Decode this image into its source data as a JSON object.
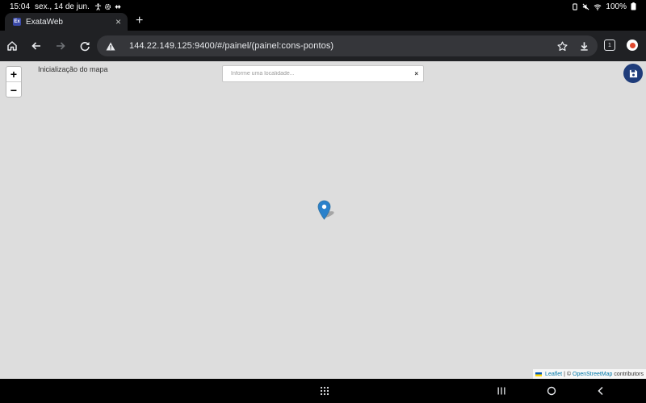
{
  "status_bar": {
    "time": "15:04",
    "date": "sex., 14 de jun.",
    "battery": "100%"
  },
  "tab": {
    "favicon_text": "Ex",
    "title": "ExataWeb",
    "close_symbol": "×",
    "new_tab_symbol": "+"
  },
  "toolbar": {
    "url": "144.22.149.125:9400/#/painel/(painel:cons-pontos)",
    "tab_count": "1"
  },
  "map": {
    "title": "Inicialização do mapa",
    "zoom_in_label": "+",
    "zoom_out_label": "−",
    "search_placeholder": "Informe uma localidade...",
    "search_clear": "×",
    "attribution": {
      "leaflet": "Leaflet",
      "separator": "| ©",
      "osm": "OpenStreetMap",
      "contributors": "contributors"
    }
  },
  "colors": {
    "map_background": "#dddddd",
    "marker": "#2a81cb",
    "fab": "#1f3c7a"
  }
}
